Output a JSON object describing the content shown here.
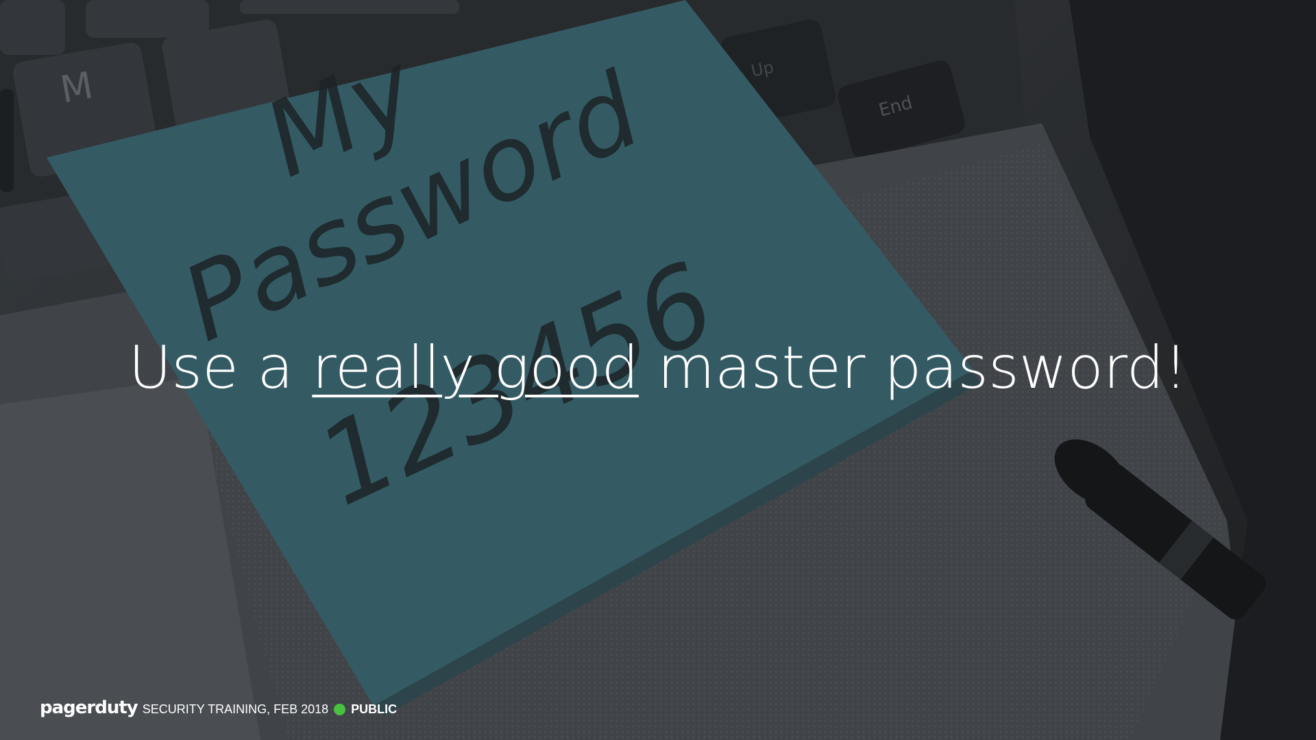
{
  "slide": {
    "note_text_line1": "My",
    "note_text_line2": "Password",
    "note_text_line3": "123456",
    "key_m": "M",
    "key_end": "End",
    "key_pgup": "Up"
  },
  "headline": {
    "before": "Use a ",
    "emphasis": "really good",
    "after": " master password!"
  },
  "footer": {
    "brand": "pagerduty",
    "event": "SECURITY TRAINING, FEB 2018",
    "classification": "PUBLIC",
    "status_color": "#47c13f"
  },
  "colors": {
    "note": "#3b6b74",
    "ink": "#1d2628",
    "text": "#ffffff"
  }
}
